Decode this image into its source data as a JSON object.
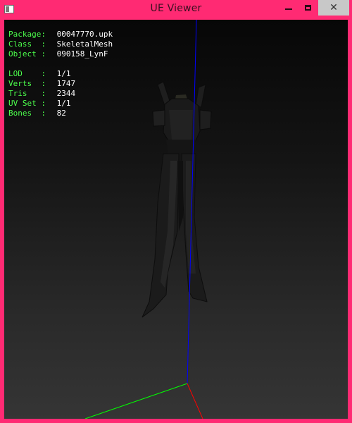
{
  "window": {
    "title": "UE Viewer",
    "close_glyph": "✕"
  },
  "info": {
    "package": {
      "key": "Package:",
      "value": "00047770.upk"
    },
    "class": {
      "key": "Class  :",
      "value": "SkeletalMesh"
    },
    "object": {
      "key": "Object :",
      "value": "090158_LynF"
    },
    "lod": {
      "key": "LOD    :",
      "value": "1/1"
    },
    "verts": {
      "key": "Verts  :",
      "value": "1747"
    },
    "tris": {
      "key": "Tris   :",
      "value": "2344"
    },
    "uvset": {
      "key": "UV Set :",
      "value": "1/1"
    },
    "bones": {
      "key": "Bones  :",
      "value": "82"
    }
  },
  "colors": {
    "frame": "#FF2A73",
    "info_key": "#4CFF4C",
    "info_value": "#FFFFFF",
    "axis_x": "#FF0000",
    "axis_y": "#00FF00",
    "axis_z": "#0000FF"
  }
}
